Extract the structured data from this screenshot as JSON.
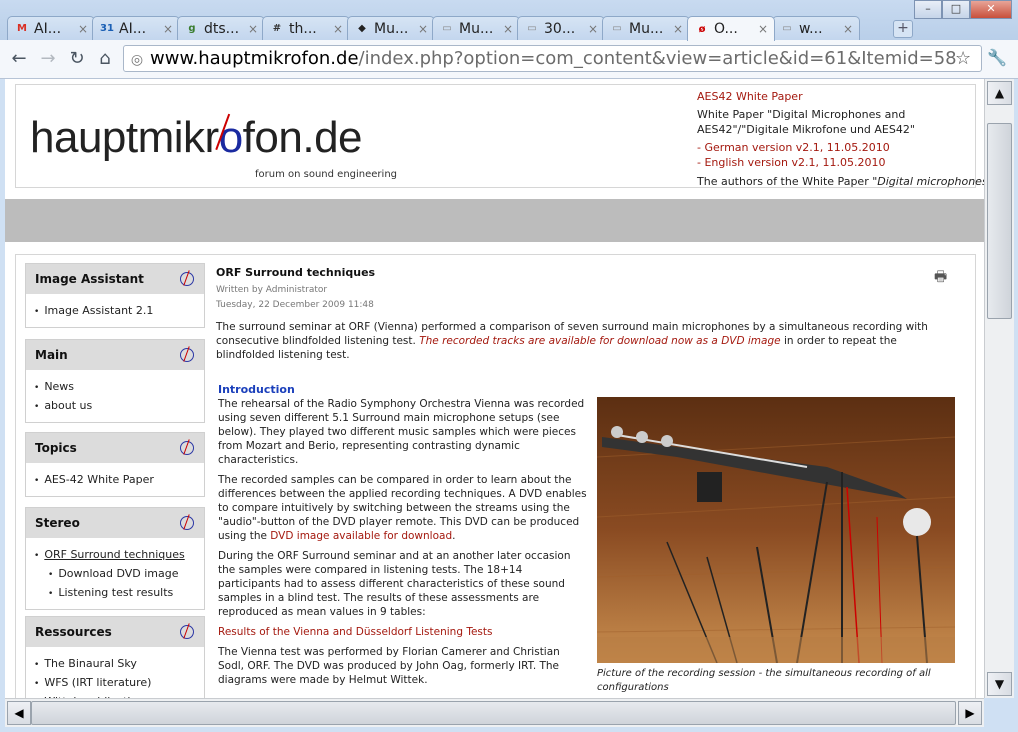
{
  "tabs": [
    {
      "label": "AI...",
      "icon": "gmail-icon",
      "glyph": "M",
      "color": "#d93025"
    },
    {
      "label": "AI...",
      "icon": "calendar-icon",
      "glyph": "31",
      "color": "#1a5fb4"
    },
    {
      "label": "dts...",
      "icon": "google-icon",
      "glyph": "g",
      "color": "#3a7d2f"
    },
    {
      "label": "th...",
      "icon": "grid-icon",
      "glyph": "#",
      "color": "#333"
    },
    {
      "label": "Mu...",
      "icon": "linux-icon",
      "glyph": "◆",
      "color": "#222"
    },
    {
      "label": "Mu...",
      "icon": "page-icon",
      "glyph": "▭",
      "color": "#888"
    },
    {
      "label": "30...",
      "icon": "page-icon",
      "glyph": "▭",
      "color": "#888"
    },
    {
      "label": "Mu...",
      "icon": "page-icon",
      "glyph": "▭",
      "color": "#888"
    },
    {
      "label": "O...",
      "icon": "hauptmikrofon-icon",
      "glyph": "ø",
      "color": "#c00"
    },
    {
      "label": "w...",
      "icon": "page-icon",
      "glyph": "▭",
      "color": "#888"
    }
  ],
  "address": {
    "host": "www.hauptmikrofon.de",
    "path": "/index.php?option=com_content&view=article&id=61&Itemid=58"
  },
  "header": {
    "logo": "hauptmikrofon.de",
    "tagline": "forum on sound engineering",
    "news_title": "AES42 White Paper",
    "news_body": "White Paper \"Digital Microphones and AES42\"/\"Digitale Mikrofone und AES42\"",
    "news_german": "- German version v2.1, 11.05.2010",
    "news_english": "- English version v2.1, 11.05.2010",
    "news_authors_prefix": "The authors of the White Paper",
    "news_authors_italic": "\"Digital microphones and"
  },
  "sidebar": [
    {
      "title": "Image Assistant",
      "items": [
        {
          "label": "Image Assistant 2.1"
        }
      ]
    },
    {
      "title": "Main",
      "items": [
        {
          "label": "News"
        },
        {
          "label": "about us"
        }
      ]
    },
    {
      "title": "Topics",
      "items": [
        {
          "label": "AES-42 White Paper"
        }
      ]
    },
    {
      "title": "Stereo",
      "items": [
        {
          "label": "ORF Surround techniques",
          "current": true
        },
        {
          "label": "Download DVD image",
          "sub": true
        },
        {
          "label": "Listening test results",
          "sub": true
        }
      ]
    },
    {
      "title": "Ressources",
      "items": [
        {
          "label": "The Binaural Sky"
        },
        {
          "label": "WFS (IRT literature)"
        },
        {
          "label": "Wittek publications"
        }
      ]
    }
  ],
  "article": {
    "title": "ORF Surround techniques",
    "author": "Written by Administrator",
    "date": "Tuesday, 22 December 2009 11:48",
    "intro_1": "The surround seminar at ORF (Vienna) performed a comparison of seven surround main microphones by a simultaneous recording with consecutive blindfolded listening test.",
    "intro_link": "The recorded tracks are available for download now as a DVD image",
    "intro_2": "in order to repeat the blindfolded listening test.",
    "section_heading": "Introduction",
    "para_1": "The rehearsal of the Radio Symphony Orchestra Vienna was recorded using seven different 5.1 Surround main microphone setups (see below). They played two different music samples which were pieces from Mozart and Berio, representing contrasting dynamic characteristics.",
    "para_2a": "The recorded samples can be compared in order to learn about the differences between the applied recording techniques. A DVD enables to compare intuitively by switching between the streams using the \"audio\"-button of the DVD player remote. This DVD can be produced using the",
    "para_2_link": "DVD image available for download",
    "para_2b": ".",
    "para_3": "During the ORF Surround seminar and at an another later occasion the samples were compared in listening tests. The 18+14 participants had to assess different characteristics of these sound samples in a blind test. The results of these assessments are reproduced as mean values in 9 tables:",
    "results_link": "Results of the Vienna and Düsseldorf Listening Tests",
    "para_4": "The Vienna test was performed by Florian Camerer and Christian Sodl, ORF. The DVD was produced by John Oag, formerly IRT. The diagrams were made by Helmut Wittek.",
    "caption": "Picture of the recording session - the simultaneous recording of all configurations"
  }
}
